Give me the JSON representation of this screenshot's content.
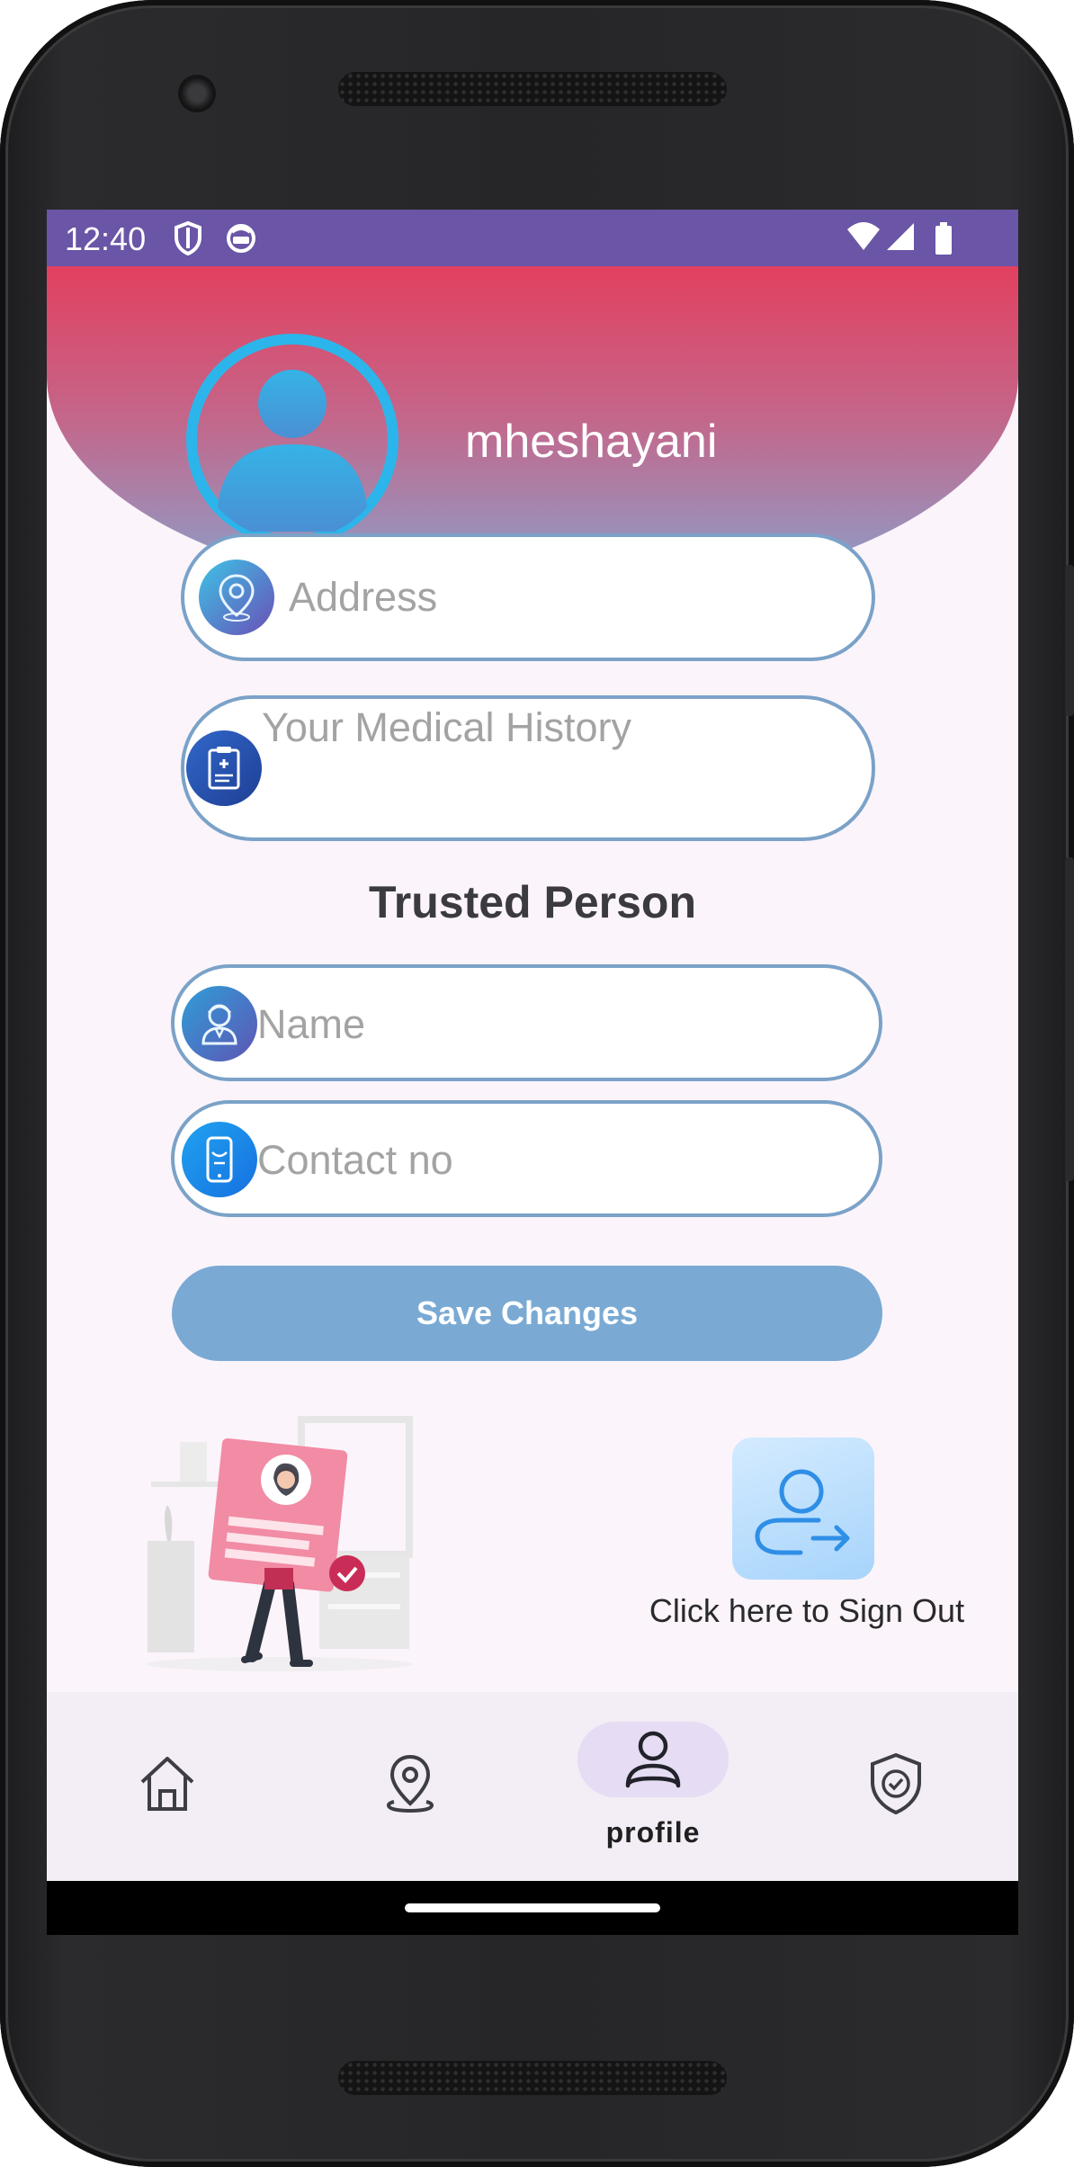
{
  "status_bar": {
    "time": "12:40",
    "left_icons": [
      "shield-icon",
      "face-mask-icon"
    ],
    "right_icons": [
      "wifi-icon",
      "signal-icon",
      "battery-icon"
    ]
  },
  "profile": {
    "username": "mheshayani",
    "avatar_icon": "user-avatar-icon"
  },
  "form": {
    "address": {
      "placeholder": "Address",
      "value": "",
      "icon": "location-icon"
    },
    "medical_history": {
      "placeholder": "Your Medical History",
      "value": "",
      "icon": "medical-clipboard-icon"
    }
  },
  "trusted_person": {
    "title": "Trusted Person",
    "name": {
      "placeholder": "Name",
      "value": "",
      "icon": "person-icon"
    },
    "contact": {
      "placeholder": "Contact no",
      "value": "",
      "icon": "phone-icon"
    }
  },
  "actions": {
    "save_label": "Save Changes",
    "sign_out_label": "Click here to Sign Out"
  },
  "bottom_nav": {
    "items": [
      {
        "icon": "home-icon",
        "label": "",
        "active": false
      },
      {
        "icon": "map-pin-icon",
        "label": "",
        "active": false
      },
      {
        "icon": "profile-icon",
        "label": "profile",
        "active": true
      },
      {
        "icon": "shield-check-icon",
        "label": "",
        "active": false
      }
    ]
  },
  "colors": {
    "status_bar": "#6a55a6",
    "header_top": "#e2405f",
    "header_bottom": "#85a6cf",
    "field_border": "#7ba2c8",
    "save_button": "#7aaad3",
    "nav_active_pill": "#e6dcf3"
  }
}
